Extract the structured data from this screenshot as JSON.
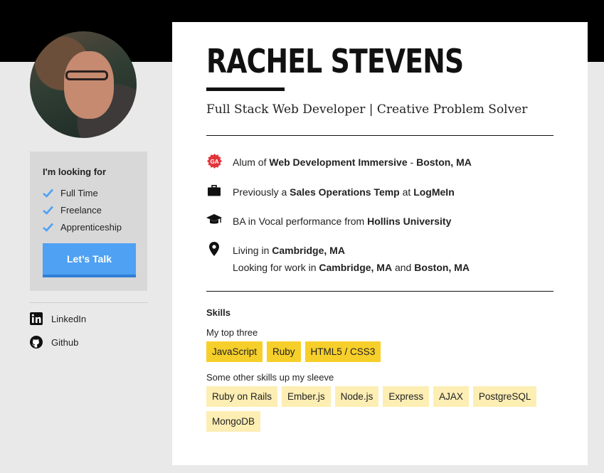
{
  "profile": {
    "name": "RACHEL STEVENS",
    "tagline": "Full Stack Web Developer | Creative Problem Solver"
  },
  "sidebar": {
    "looking_title": "I'm looking for",
    "looking_items": [
      "Full Time",
      "Freelance",
      "Apprenticeship"
    ],
    "cta_label": "Let’s Talk",
    "links": [
      {
        "label": "LinkedIn",
        "icon": "linkedin-icon"
      },
      {
        "label": "Github",
        "icon": "github-icon"
      }
    ]
  },
  "info": {
    "ga": {
      "t1": "Alum of ",
      "b1": "Web Development Immersive",
      "t2": " - ",
      "b2": "Boston, MA",
      "icon": "ga-logo-icon"
    },
    "job": {
      "t1": "Previously a ",
      "b1": "Sales Operations Temp",
      "t2": " at ",
      "b2": "LogMeIn",
      "icon": "briefcase-icon"
    },
    "edu": {
      "t1": "BA in Vocal performance from ",
      "b1": "Hollins University",
      "icon": "graduation-cap-icon"
    },
    "location": {
      "t1": "Living in ",
      "b1": "Cambridge, MA",
      "t2": "Looking for work in ",
      "b2": "Cambridge, MA",
      "t3": " and ",
      "b3": "Boston, MA",
      "icon": "map-pin-icon"
    }
  },
  "skills": {
    "title": "Skills",
    "top_label": "My top three",
    "top": [
      "JavaScript",
      "Ruby",
      "HTML5 / CSS3"
    ],
    "other_label": "Some other skills up my sleeve",
    "other": [
      "Ruby on Rails",
      "Ember.js",
      "Node.js",
      "Express",
      "AJAX",
      "PostgreSQL",
      "MongoDB"
    ]
  },
  "colors": {
    "accent_blue": "#4ea1f3",
    "top_tag": "#f7cf2a",
    "other_tag": "#fdeeb4",
    "ga_red": "#e4343a"
  }
}
